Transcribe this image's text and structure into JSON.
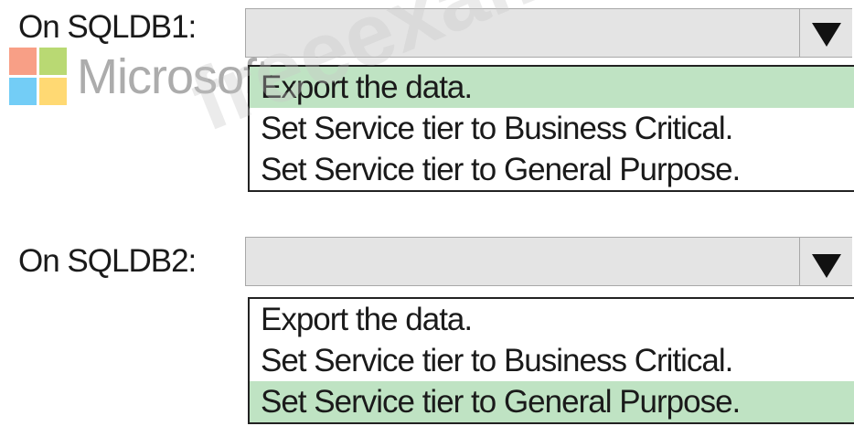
{
  "watermark": {
    "brand": "Microsoft",
    "logo_colors": [
      "#f25022",
      "#7fba00",
      "#00a4ef",
      "#ffb900"
    ],
    "site": "freeexam.net"
  },
  "questions": [
    {
      "label": "On SQLDB1:",
      "selected_value": "",
      "options": [
        {
          "text": "Export the data.",
          "selected": true
        },
        {
          "text": "Set Service tier to Business Critical.",
          "selected": false
        },
        {
          "text": "Set Service tier to General Purpose.",
          "selected": false
        }
      ]
    },
    {
      "label": "On SQLDB2:",
      "selected_value": "",
      "options": [
        {
          "text": "Export the data.",
          "selected": false
        },
        {
          "text": "Set Service tier to Business Critical.",
          "selected": false
        },
        {
          "text": "Set Service tier to General Purpose.",
          "selected": true
        }
      ]
    }
  ],
  "colors": {
    "selected_highlight": "#bfe3c3",
    "dropdown_bg": "#e4e4e4"
  },
  "icons": {
    "dropdown_arrow": "triangle-down-icon"
  }
}
